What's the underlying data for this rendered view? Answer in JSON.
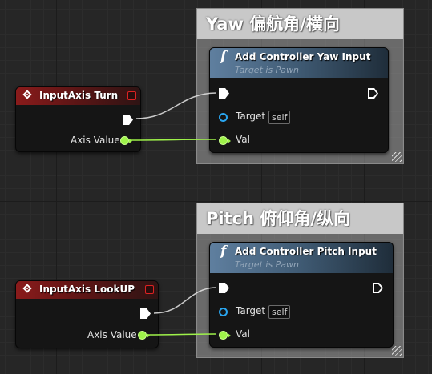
{
  "comments": [
    {
      "title": "Yaw 偏航角/横向"
    },
    {
      "title": "Pitch 俯仰角/纵向"
    }
  ],
  "input_nodes": [
    {
      "title": "InputAxis Turn",
      "output_label": "Axis Value"
    },
    {
      "title": "InputAxis LookUP",
      "output_label": "Axis Value"
    }
  ],
  "func_nodes": [
    {
      "icon": "f",
      "title": "Add Controller Yaw Input",
      "subtitle": "Target is Pawn",
      "target_label": "Target",
      "target_value": "self",
      "val_label": "Val"
    },
    {
      "icon": "f",
      "title": "Add Controller Pitch Input",
      "subtitle": "Target is Pawn",
      "target_label": "Target",
      "target_value": "self",
      "val_label": "Val"
    }
  ],
  "colors": {
    "event_header": "#8a1b1b",
    "function_header": "#5f7f9f",
    "float_pin": "#9ef24a",
    "object_pin": "#2aa6f0",
    "exec_wire": "#e6e6e6",
    "float_wire": "#9ef24a"
  }
}
